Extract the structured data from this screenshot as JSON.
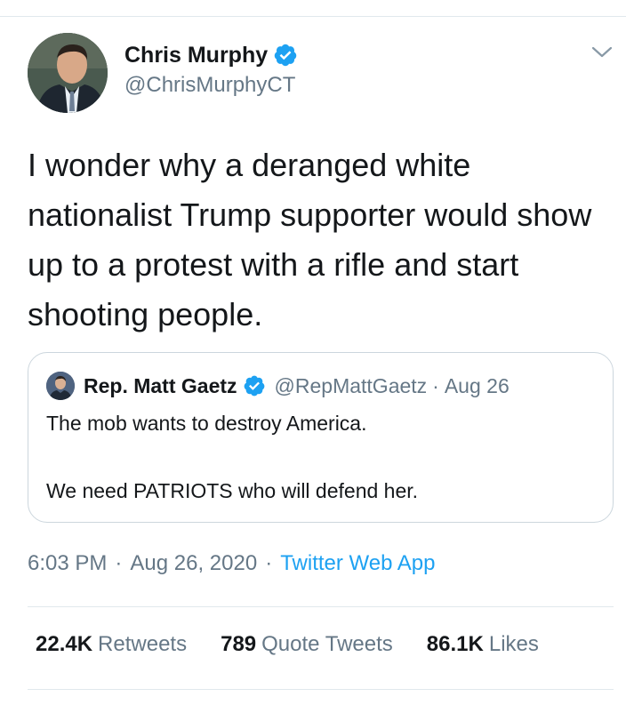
{
  "tweet": {
    "author": {
      "display_name": "Chris Murphy",
      "handle": "@ChrisMurphyCT",
      "verified": true,
      "avatar_icon": "profile-photo"
    },
    "text": "I wonder why a deranged white nationalist Trump supporter would show up to a protest with a rifle and start shooting people.",
    "menu_icon": "chevron-down-icon",
    "quoted_tweet": {
      "display_name": "Rep. Matt Gaetz",
      "handle": "@RepMattGaetz",
      "separator": "·",
      "date": "Aug 26",
      "verified": true,
      "lines": [
        "The mob wants to destroy America.",
        "We need PATRIOTS who will defend her."
      ]
    },
    "meta": {
      "time": "6:03 PM",
      "separator": "·",
      "date": "Aug 26, 2020",
      "source": "Twitter Web App"
    },
    "stats": [
      {
        "value": "22.4K",
        "label": "Retweets"
      },
      {
        "value": "789",
        "label": "Quote Tweets"
      },
      {
        "value": "86.1K",
        "label": "Likes"
      }
    ]
  },
  "colors": {
    "text_primary": "#14171a",
    "text_secondary": "#657786",
    "accent_blue": "#1da1f2",
    "divider": "#e1e8ed"
  }
}
